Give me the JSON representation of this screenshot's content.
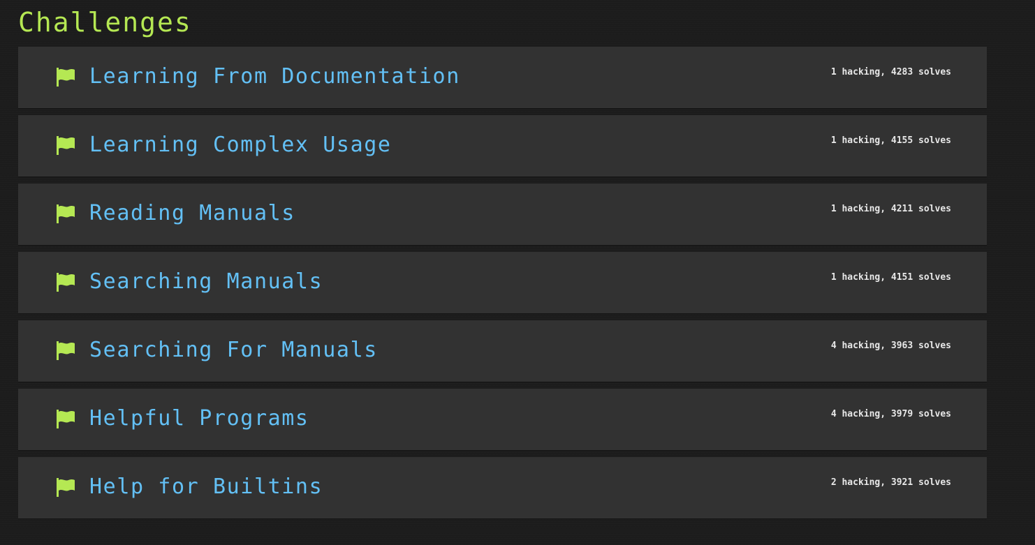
{
  "page": {
    "title": "Challenges"
  },
  "colors": {
    "background": "#1c1c1c",
    "card": "#323232",
    "title": "#b5e853",
    "flag": "#b5e853",
    "challenge_name": "#63c0f5",
    "stats": "#e8e8e8"
  },
  "challenges": [
    {
      "name": "Learning From Documentation",
      "stats": "1 hacking, 4283 solves",
      "icon": "flag-icon"
    },
    {
      "name": "Learning Complex Usage",
      "stats": "1 hacking, 4155 solves",
      "icon": "flag-icon"
    },
    {
      "name": "Reading Manuals",
      "stats": "1 hacking, 4211 solves",
      "icon": "flag-icon"
    },
    {
      "name": "Searching Manuals",
      "stats": "1 hacking, 4151 solves",
      "icon": "flag-icon"
    },
    {
      "name": "Searching For Manuals",
      "stats": "4 hacking, 3963 solves",
      "icon": "flag-icon"
    },
    {
      "name": "Helpful Programs",
      "stats": "4 hacking, 3979 solves",
      "icon": "flag-icon"
    },
    {
      "name": "Help for Builtins",
      "stats": "2 hacking, 3921 solves",
      "icon": "flag-icon"
    }
  ]
}
